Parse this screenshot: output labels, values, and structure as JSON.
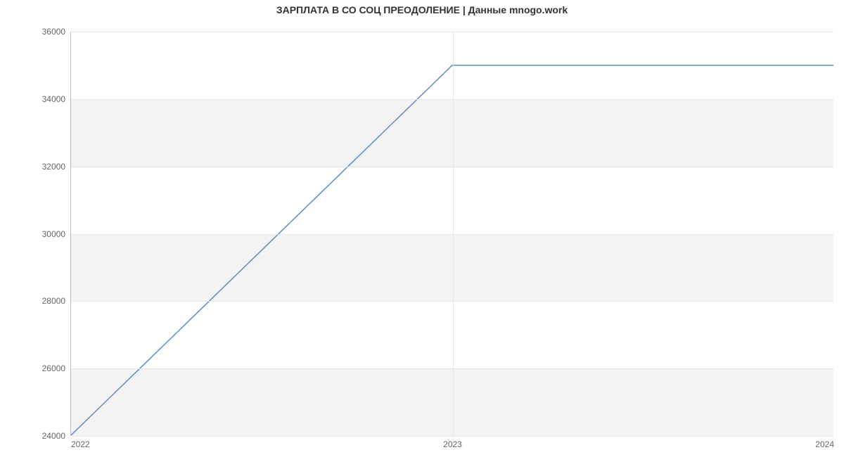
{
  "chart_data": {
    "type": "line",
    "title": "ЗАРПЛАТА В СО СОЦ ПРЕОДОЛЕНИЕ | Данные mnogo.work",
    "xlabel": "",
    "ylabel": "",
    "x_ticks": [
      "2022",
      "2023",
      "2024"
    ],
    "y_ticks": [
      24000,
      26000,
      28000,
      30000,
      32000,
      34000,
      36000
    ],
    "ylim": [
      24000,
      36000
    ],
    "x": [
      2022,
      2023,
      2024
    ],
    "values": [
      24000,
      35000,
      35000
    ],
    "line_color": "#5e8bc0",
    "grid": true
  }
}
